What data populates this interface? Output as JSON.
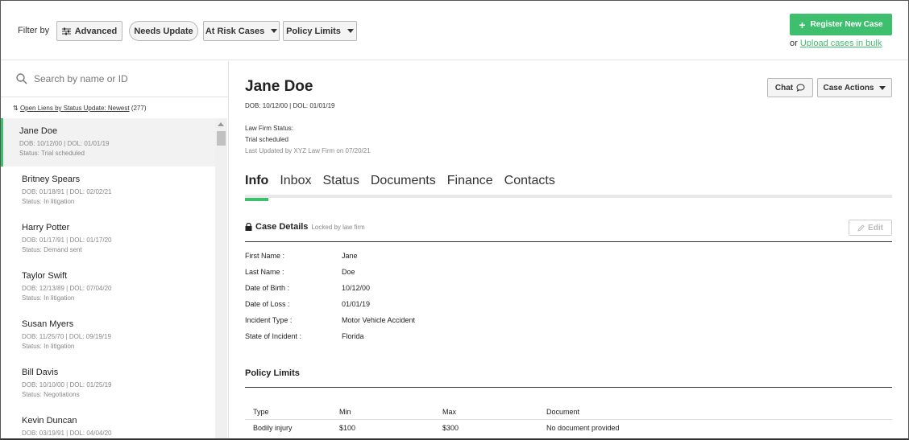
{
  "filters": {
    "label": "Filter by",
    "advanced": "Advanced",
    "needs_update": "Needs Update",
    "at_risk": "At Risk Cases",
    "policy_limits": "Policy Limits"
  },
  "register": {
    "label": "Register New Case",
    "or": "or",
    "bulk_link": "Upload cases in bulk"
  },
  "search": {
    "placeholder": "Search by name or ID"
  },
  "sort": {
    "link": "Open Liens by Status Update: Newest",
    "count": "(277)"
  },
  "cases": [
    {
      "name": "Jane Doe",
      "dates": "DOB: 10/12/00 | DOL: 01/01/19",
      "status": "Status: Trial scheduled"
    },
    {
      "name": "Britney Spears",
      "dates": "DOB: 01/18/91 | DOL: 02/02/21",
      "status": "Status: In litigation"
    },
    {
      "name": "Harry Potter",
      "dates": "DOB: 01/17/91 | DOL: 01/17/20",
      "status": "Status: Demand sent"
    },
    {
      "name": "Taylor Swift",
      "dates": "DOB: 12/13/89 | DOL: 07/04/20",
      "status": "Status: In litigation"
    },
    {
      "name": "Susan Myers",
      "dates": "DOB: 11/25/70 | DOL: 09/19/19",
      "status": "Status: In litigation"
    },
    {
      "name": "Bill Davis",
      "dates": "DOB: 10/10/00 | DOL: 01/25/19",
      "status": "Status: Negotiations"
    },
    {
      "name": "Kevin Duncan",
      "dates": "DOB: 03/19/91 | DOL: 04/04/20",
      "status": ""
    }
  ],
  "case": {
    "name": "Jane Doe",
    "dates": "DOB: 10/12/00 | DOL: 01/01/19",
    "firm_status_label": "Law Firm Status:",
    "firm_status": "Trial scheduled",
    "last_updated": "Last Updated by XYZ Law Firm on 07/20/21"
  },
  "actions": {
    "chat": "Chat",
    "case_actions": "Case Actions"
  },
  "tabs": [
    "Info",
    "Inbox",
    "Status",
    "Documents",
    "Finance",
    "Contacts"
  ],
  "details": {
    "title": "Case Details",
    "locked": "Locked by law firm",
    "edit": "Edit",
    "fields": [
      {
        "label": "First Name :",
        "value": "Jane"
      },
      {
        "label": "Last Name :",
        "value": "Doe"
      },
      {
        "label": "Date of Birth :",
        "value": "10/12/00"
      },
      {
        "label": "Date of Loss :",
        "value": "01/01/19"
      },
      {
        "label": "Incident Type :",
        "value": "Motor Vehicle Accident"
      },
      {
        "label": "State of Incident :",
        "value": "Florida"
      }
    ]
  },
  "policy": {
    "title": "Policy Limits",
    "headers": [
      "Type",
      "Min",
      "Max",
      "Document"
    ],
    "rows": [
      [
        "Bodily injury",
        "$100",
        "$300",
        "No document provided"
      ]
    ]
  },
  "colors": {
    "accent": "#3dbf6e"
  },
  "icons": [
    "sliders-icon",
    "caret-down-icon",
    "plus-icon",
    "search-icon",
    "sort-icon",
    "chat-bubble-icon",
    "lock-icon",
    "pencil-icon",
    "scroll-up-icon"
  ]
}
